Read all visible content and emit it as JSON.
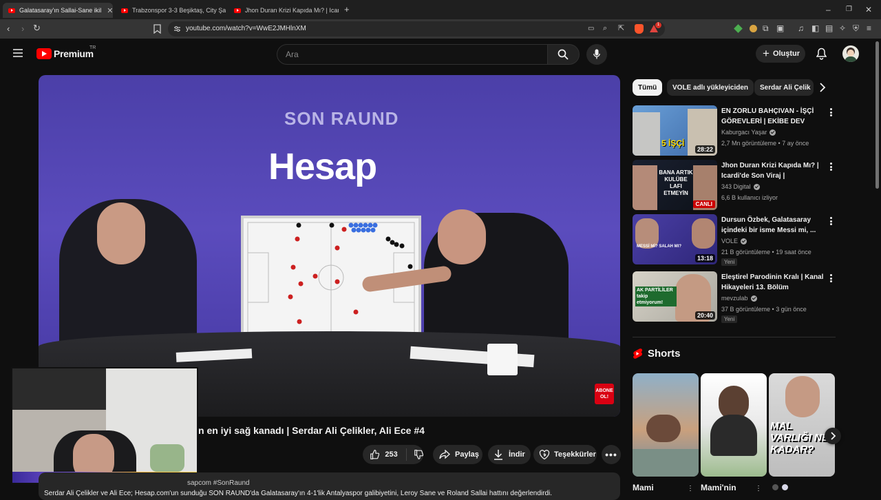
{
  "browser": {
    "tabs": [
      {
        "label": "Galatasaray'ın Sallai-Sane ikil",
        "active": true
      },
      {
        "label": "Trabzonspor 3-3 Beşiktaş, City Şamp",
        "active": false
      },
      {
        "label": "Jhon Duran Krizi Kapıda Mı? | Icardi'd",
        "active": false
      }
    ],
    "url": "youtube.com/watch?v=WwE2JMHlnXM",
    "notification_count": "1"
  },
  "header": {
    "logo_text": "Premium",
    "region": "TR",
    "search_placeholder": "Ara",
    "create_label": "Oluştur"
  },
  "video": {
    "title_partial": "n en iyi sağ kanadı | Serdar Ali Çelikler, Ali Ece #4",
    "overlay_show": "SON RAUND",
    "overlay_brand": "Hesap",
    "subscribe_badge": "ABONE OL!",
    "like_count": "253",
    "share_label": "Paylaş",
    "download_label": "İndir",
    "thanks_label": "Teşekkürler",
    "desc_tags": "sapcom #SonRaund",
    "desc_text": "Serdar Ali Çelikler ve Ali Ece; Hesap.com'un sunduğu SON RAUND'da Galatasaray'ın 4-1'lik Antalyaspor galibiyetini, Leroy Sane ve Roland Sallai hattını değerlendirdi."
  },
  "chips": [
    "Tümü",
    "VOLE adlı yükleyiciden",
    "Serdar Ali Çelik"
  ],
  "recommendations": [
    {
      "title": "EN ZORLU BAHÇIVAN - İŞÇİ GÖREVLERİ | EKİBE DEV PUSU",
      "channel": "Kaburgacı Yaşar",
      "meta": "2,7 Mn görüntüleme • 7 ay önce",
      "duration": "28:22",
      "badge": "",
      "thumb_text": "5 İŞÇİ"
    },
    {
      "title": "Jhon Duran Krizi Kapıda Mı? | Icardi'de Son Viraj | Galatasara...",
      "channel": "343 Digital",
      "meta": "6,6 B kullanıcı izliyor",
      "duration": "",
      "live": "CANLI",
      "badge": "",
      "thumb_text": "BANA ARTIK KULÜBE LAFI ETMEYİN"
    },
    {
      "title": "Dursun Özbek, Galatasaray içindeki bir isme Messi mi, ...",
      "channel": "VOLE",
      "meta": "21 B görüntüleme • 19 saat önce",
      "duration": "13:18",
      "badge": "Yeni",
      "thumb_text": "MESSİ Mİ? SALAH MI?"
    },
    {
      "title": "Eleştirel Parodinin Kralı | Kanal Hikayeleri 13. Bölüm",
      "channel": "mevzulab",
      "meta": "37 B görüntüleme • 3 gün önce",
      "duration": "20:40",
      "badge": "Yeni",
      "thumb_text": "AK PARTİLİLER takip etmiyorum!"
    }
  ],
  "shorts": {
    "heading": "Shorts",
    "items": [
      {
        "title": "Mami"
      },
      {
        "title": "Mami'nin"
      },
      {
        "title": "MAL VARLIĞI NE KADAR?"
      }
    ]
  },
  "colors": {
    "accent": "#ff0000",
    "bg": "#0f0f0f",
    "surface": "#272727",
    "video_bg": "#5046b3"
  }
}
